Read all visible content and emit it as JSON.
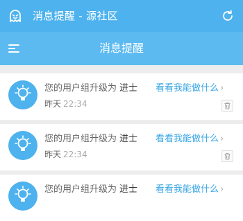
{
  "app": {
    "title": "消息提醒 - 源社区",
    "app_icon": "ghost-icon",
    "refresh_icon": "refresh-icon",
    "accent": "#4db2ee"
  },
  "navbar": {
    "title": "消息提醒",
    "menu_icon": "menu-icon"
  },
  "messages": [
    {
      "text": "您的用户组升级为",
      "rank": "进士",
      "link": "看看我能做什么",
      "chevron": "›",
      "day": "昨天",
      "time": "22:34"
    },
    {
      "text": "您的用户组升级为",
      "rank": "进士",
      "link": "看看我能做什么",
      "chevron": "›",
      "day": "昨天",
      "time": "22:34"
    },
    {
      "text": "您的用户组升级为",
      "rank": "进士",
      "link": "看看我能做什么",
      "chevron": "›",
      "day": "",
      "time": ""
    }
  ]
}
